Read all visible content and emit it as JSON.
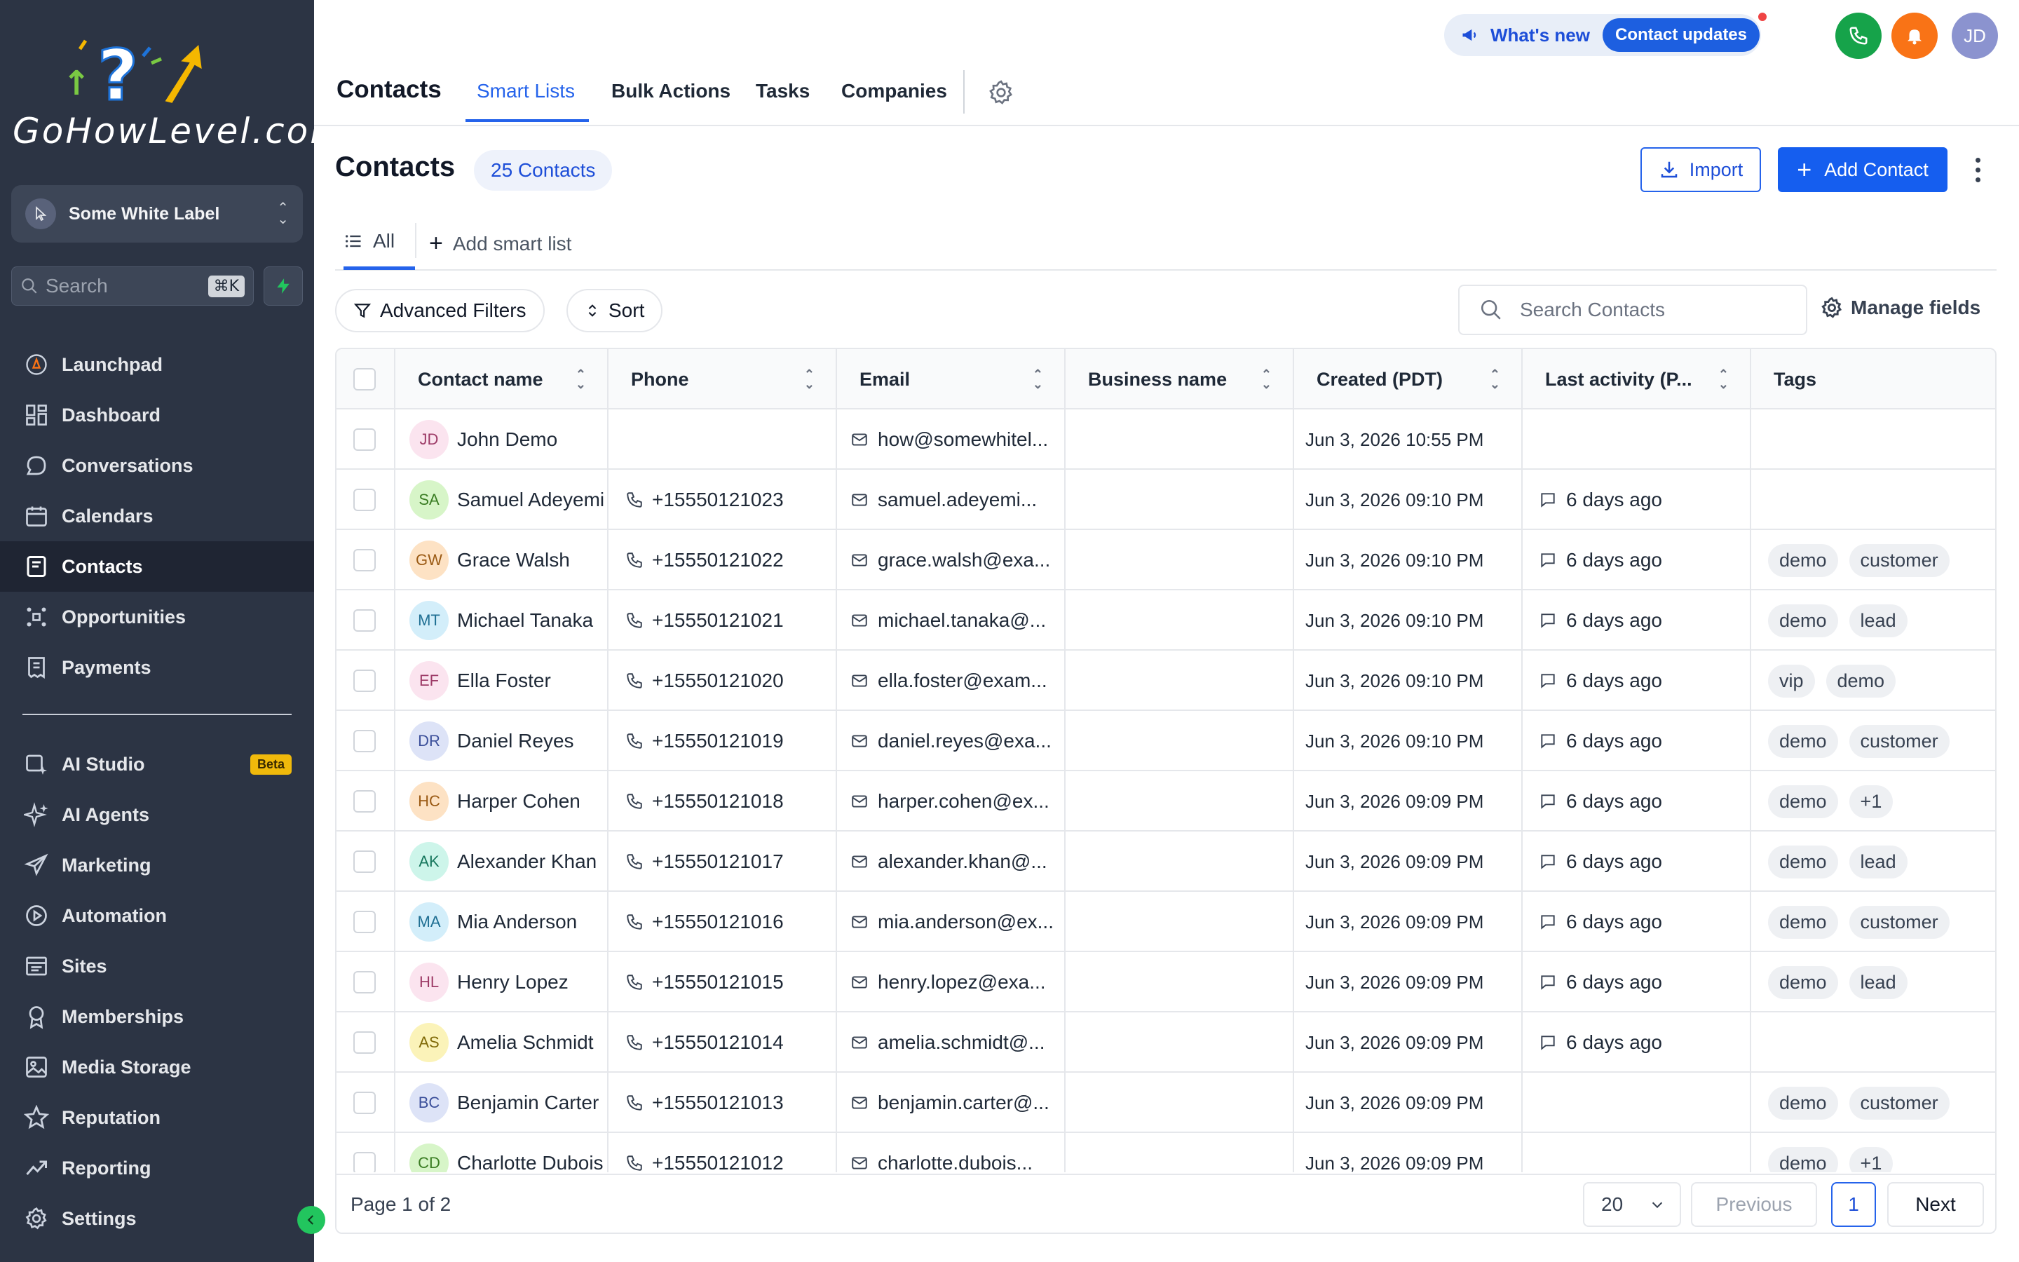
{
  "sidebar": {
    "logo_text": "GoHowLevel.com",
    "account_name": "Some White Label",
    "search_placeholder": "Search",
    "search_shortcut": "⌘K",
    "nav_primary": [
      {
        "label": "Launchpad",
        "icon": "rocket-icon"
      },
      {
        "label": "Dashboard",
        "icon": "grid-icon"
      },
      {
        "label": "Conversations",
        "icon": "chat-icon"
      },
      {
        "label": "Calendars",
        "icon": "calendar-icon"
      },
      {
        "label": "Contacts",
        "icon": "contacts-icon",
        "active": true
      },
      {
        "label": "Opportunities",
        "icon": "network-icon"
      },
      {
        "label": "Payments",
        "icon": "receipt-icon"
      }
    ],
    "nav_secondary": [
      {
        "label": "AI Studio",
        "icon": "ai-studio-icon",
        "badge": "Beta"
      },
      {
        "label": "AI Agents",
        "icon": "sparkle-icon"
      },
      {
        "label": "Marketing",
        "icon": "send-icon"
      },
      {
        "label": "Automation",
        "icon": "automation-icon"
      },
      {
        "label": "Sites",
        "icon": "sites-icon"
      },
      {
        "label": "Memberships",
        "icon": "badge-icon"
      },
      {
        "label": "Media Storage",
        "icon": "image-icon"
      },
      {
        "label": "Reputation",
        "icon": "star-icon"
      },
      {
        "label": "Reporting",
        "icon": "trend-icon"
      },
      {
        "label": "Settings",
        "icon": "gear-icon"
      }
    ]
  },
  "topbar": {
    "heading": "Contacts",
    "tabs": [
      "Smart Lists",
      "Bulk Actions",
      "Tasks",
      "Companies"
    ],
    "active_tab": "Smart Lists",
    "whats_new": "What's new",
    "contact_updates": "Contact updates",
    "avatar_initials": "JD",
    "colors": {
      "phone": "#16a34a",
      "bell": "#f97316",
      "avatar": "#8b93cf"
    }
  },
  "main": {
    "title": "Contacts",
    "count_badge": "25 Contacts",
    "import_label": "Import",
    "add_contact_label": "Add Contact",
    "list_tab_all": "All",
    "add_smart_list": "Add smart list",
    "advanced_filters": "Advanced Filters",
    "sort": "Sort",
    "search_placeholder": "Search Contacts",
    "manage_fields": "Manage fields"
  },
  "table": {
    "columns": [
      "Contact name",
      "Phone",
      "Email",
      "Business name",
      "Created (PDT)",
      "Last activity (P...",
      "Tags"
    ],
    "rows": [
      {
        "initials": "JD",
        "name": "John Demo",
        "phone": "",
        "email": "how@somewhitel...",
        "created": "Jun 3, 2026 10:55 PM",
        "activity": "",
        "tags": [],
        "avatar_bg": "#fbe4ef",
        "avatar_fg": "#9d3b67"
      },
      {
        "initials": "SA",
        "name": "Samuel Adeyemi",
        "phone": "+15550121023",
        "email": "samuel.adeyemi...",
        "created": "Jun 3, 2026 09:10 PM",
        "activity": "6 days ago",
        "tags": [],
        "avatar_bg": "#d7f5c8",
        "avatar_fg": "#3a7d23"
      },
      {
        "initials": "GW",
        "name": "Grace Walsh",
        "phone": "+15550121022",
        "email": "grace.walsh@exa...",
        "created": "Jun 3, 2026 09:10 PM",
        "activity": "6 days ago",
        "tags": [
          "demo",
          "customer"
        ],
        "avatar_bg": "#fde2c4",
        "avatar_fg": "#9a5a14"
      },
      {
        "initials": "MT",
        "name": "Michael Tanaka",
        "phone": "+15550121021",
        "email": "michael.tanaka@...",
        "created": "Jun 3, 2026 09:10 PM",
        "activity": "6 days ago",
        "tags": [
          "demo",
          "lead"
        ],
        "avatar_bg": "#d3eefa",
        "avatar_fg": "#1f6f93"
      },
      {
        "initials": "EF",
        "name": "Ella Foster",
        "phone": "+15550121020",
        "email": "ella.foster@exam...",
        "created": "Jun 3, 2026 09:10 PM",
        "activity": "6 days ago",
        "tags": [
          "vip",
          "demo"
        ],
        "avatar_bg": "#fbe4ef",
        "avatar_fg": "#9d3b67"
      },
      {
        "initials": "DR",
        "name": "Daniel Reyes",
        "phone": "+15550121019",
        "email": "daniel.reyes@exa...",
        "created": "Jun 3, 2026 09:10 PM",
        "activity": "6 days ago",
        "tags": [
          "demo",
          "customer"
        ],
        "avatar_bg": "#dde3f7",
        "avatar_fg": "#3b4f9a"
      },
      {
        "initials": "HC",
        "name": "Harper Cohen",
        "phone": "+15550121018",
        "email": "harper.cohen@ex...",
        "created": "Jun 3, 2026 09:09 PM",
        "activity": "6 days ago",
        "tags": [
          "demo",
          "+1"
        ],
        "avatar_bg": "#fde2c4",
        "avatar_fg": "#9a5a14"
      },
      {
        "initials": "AK",
        "name": "Alexander Khan",
        "phone": "+15550121017",
        "email": "alexander.khan@...",
        "created": "Jun 3, 2026 09:09 PM",
        "activity": "6 days ago",
        "tags": [
          "demo",
          "lead"
        ],
        "avatar_bg": "#cdf5ea",
        "avatar_fg": "#17775d"
      },
      {
        "initials": "MA",
        "name": "Mia Anderson",
        "phone": "+15550121016",
        "email": "mia.anderson@ex...",
        "created": "Jun 3, 2026 09:09 PM",
        "activity": "6 days ago",
        "tags": [
          "demo",
          "customer"
        ],
        "avatar_bg": "#d3eefa",
        "avatar_fg": "#1f6f93"
      },
      {
        "initials": "HL",
        "name": "Henry Lopez",
        "phone": "+15550121015",
        "email": "henry.lopez@exa...",
        "created": "Jun 3, 2026 09:09 PM",
        "activity": "6 days ago",
        "tags": [
          "demo",
          "lead"
        ],
        "avatar_bg": "#fbe4ef",
        "avatar_fg": "#9d3b67"
      },
      {
        "initials": "AS",
        "name": "Amelia Schmidt",
        "phone": "+15550121014",
        "email": "amelia.schmidt@...",
        "created": "Jun 3, 2026 09:09 PM",
        "activity": "6 days ago",
        "tags": [],
        "avatar_bg": "#fbf3b9",
        "avatar_fg": "#806a08"
      },
      {
        "initials": "BC",
        "name": "Benjamin Carter",
        "phone": "+15550121013",
        "email": "benjamin.carter@...",
        "created": "Jun 3, 2026 09:09 PM",
        "activity": "",
        "tags": [
          "demo",
          "customer"
        ],
        "avatar_bg": "#dde3f7",
        "avatar_fg": "#3b4f9a"
      },
      {
        "initials": "CD",
        "name": "Charlotte Dubois",
        "phone": "+15550121012",
        "email": "charlotte.dubois...",
        "created": "Jun 3, 2026 09:09 PM",
        "activity": "",
        "tags": [
          "demo",
          "+1"
        ],
        "avatar_bg": "#d7f5c8",
        "avatar_fg": "#3a7d23"
      }
    ]
  },
  "pagination": {
    "page_label": "Page 1 of 2",
    "page_size": "20",
    "previous": "Previous",
    "current": "1",
    "next": "Next"
  }
}
